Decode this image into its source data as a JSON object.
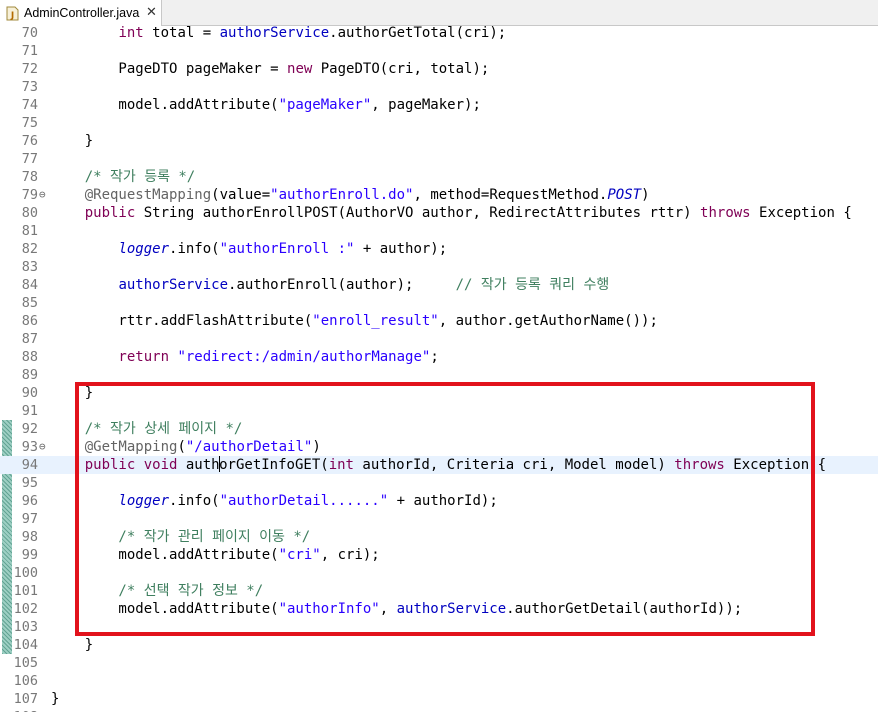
{
  "tab": {
    "title": "AdminController.java",
    "icon": "java-file-icon",
    "close": "✕"
  },
  "colors": {
    "keyword": "#7f0055",
    "string": "#2a00ff",
    "comment": "#3f7f5f",
    "annotation": "#646464",
    "field": "#0000c0",
    "highlight_border": "#e2121c",
    "current_line": "#e8f2fe"
  },
  "editor": {
    "lines": [
      {
        "n": "70",
        "tokens": [
          [
            "p",
            "        "
          ],
          [
            "kw",
            "int"
          ],
          [
            "p",
            " total = "
          ],
          [
            "fld",
            "authorService"
          ],
          [
            "p",
            ".authorGetTotal(cri);"
          ]
        ]
      },
      {
        "n": "71",
        "tokens": []
      },
      {
        "n": "72",
        "tokens": [
          [
            "p",
            "        PageDTO pageMaker = "
          ],
          [
            "kw",
            "new"
          ],
          [
            "p",
            " PageDTO(cri, total);"
          ]
        ]
      },
      {
        "n": "73",
        "tokens": []
      },
      {
        "n": "74",
        "tokens": [
          [
            "p",
            "        model.addAttribute("
          ],
          [
            "str",
            "\"pageMaker\""
          ],
          [
            "p",
            ", pageMaker);"
          ]
        ]
      },
      {
        "n": "75",
        "tokens": []
      },
      {
        "n": "76",
        "tokens": [
          [
            "p",
            "    }"
          ]
        ]
      },
      {
        "n": "77",
        "tokens": []
      },
      {
        "n": "78",
        "tokens": [
          [
            "com",
            "    /* 작가 등록 */"
          ]
        ]
      },
      {
        "n": "79",
        "fold": "⊖",
        "tokens": [
          [
            "ann",
            "    @RequestMapping"
          ],
          [
            "p",
            "(value="
          ],
          [
            "str",
            "\"authorEnroll.do\""
          ],
          [
            "p",
            ", method=RequestMethod."
          ],
          [
            "cst",
            "POST"
          ],
          [
            "p",
            ")"
          ]
        ]
      },
      {
        "n": "80",
        "tokens": [
          [
            "kw",
            "    public"
          ],
          [
            "p",
            " String authorEnrollPOST(AuthorVO author, RedirectAttributes rttr) "
          ],
          [
            "kw",
            "throws"
          ],
          [
            "p",
            " Exception {"
          ]
        ]
      },
      {
        "n": "81",
        "tokens": []
      },
      {
        "n": "82",
        "tokens": [
          [
            "p",
            "        "
          ],
          [
            "sfld",
            "logger"
          ],
          [
            "p",
            ".info("
          ],
          [
            "str",
            "\"authorEnroll :\""
          ],
          [
            "p",
            " + author);"
          ]
        ]
      },
      {
        "n": "83",
        "tokens": []
      },
      {
        "n": "84",
        "tokens": [
          [
            "p",
            "        "
          ],
          [
            "fld",
            "authorService"
          ],
          [
            "p",
            ".authorEnroll(author);     "
          ],
          [
            "com",
            "// 작가 등록 쿼리 수행"
          ]
        ]
      },
      {
        "n": "85",
        "tokens": []
      },
      {
        "n": "86",
        "tokens": [
          [
            "p",
            "        rttr.addFlashAttribute("
          ],
          [
            "str",
            "\"enroll_result\""
          ],
          [
            "p",
            ", author.getAuthorName());"
          ]
        ]
      },
      {
        "n": "87",
        "tokens": []
      },
      {
        "n": "88",
        "tokens": [
          [
            "kw",
            "        return"
          ],
          [
            "p",
            " "
          ],
          [
            "str",
            "\"redirect:/admin/authorManage\""
          ],
          [
            "p",
            ";"
          ]
        ]
      },
      {
        "n": "89",
        "tokens": []
      },
      {
        "n": "90",
        "tokens": [
          [
            "p",
            "    }"
          ]
        ]
      },
      {
        "n": "91",
        "tokens": []
      },
      {
        "n": "92",
        "tokens": [
          [
            "com",
            "    /* 작가 상세 페이지 */"
          ]
        ]
      },
      {
        "n": "93",
        "fold": "⊖",
        "tokens": [
          [
            "ann",
            "    @GetMapping"
          ],
          [
            "p",
            "("
          ],
          [
            "str",
            "\"/authorDetail\""
          ],
          [
            "p",
            ")"
          ]
        ]
      },
      {
        "n": "94",
        "current": true,
        "tokens": [
          [
            "kw",
            "    public"
          ],
          [
            "p",
            " "
          ],
          [
            "kw",
            "void"
          ],
          [
            "p",
            " auth"
          ],
          [
            "caret",
            ""
          ],
          [
            "p",
            "orGetInfoGET("
          ],
          [
            "kw",
            "int"
          ],
          [
            "p",
            " authorId, Criteria cri, Model model) "
          ],
          [
            "kw",
            "throws"
          ],
          [
            "p",
            " Exception {"
          ]
        ]
      },
      {
        "n": "95",
        "tokens": []
      },
      {
        "n": "96",
        "tokens": [
          [
            "p",
            "        "
          ],
          [
            "sfld",
            "logger"
          ],
          [
            "p",
            ".info("
          ],
          [
            "str",
            "\"authorDetail......\""
          ],
          [
            "p",
            " + authorId);"
          ]
        ]
      },
      {
        "n": "97",
        "tokens": []
      },
      {
        "n": "98",
        "tokens": [
          [
            "com",
            "        /* 작가 관리 페이지 이동 */"
          ]
        ]
      },
      {
        "n": "99",
        "tokens": [
          [
            "p",
            "        model.addAttribute("
          ],
          [
            "str",
            "\"cri\""
          ],
          [
            "p",
            ", cri);"
          ]
        ]
      },
      {
        "n": "100",
        "tokens": []
      },
      {
        "n": "101",
        "tokens": [
          [
            "com",
            "        /* 선택 작가 정보 */"
          ]
        ]
      },
      {
        "n": "102",
        "tokens": [
          [
            "p",
            "        model.addAttribute("
          ],
          [
            "str",
            "\"authorInfo\""
          ],
          [
            "p",
            ", "
          ],
          [
            "fld",
            "authorService"
          ],
          [
            "p",
            ".authorGetDetail(authorId));"
          ]
        ]
      },
      {
        "n": "103",
        "tokens": []
      },
      {
        "n": "104",
        "tokens": [
          [
            "p",
            "    }"
          ]
        ]
      },
      {
        "n": "105",
        "tokens": []
      },
      {
        "n": "106",
        "tokens": []
      },
      {
        "n": "107",
        "tokens": [
          [
            "p",
            "}"
          ]
        ]
      },
      {
        "n": "108",
        "tokens": []
      }
    ],
    "changed_ranges": [
      [
        "92",
        "104"
      ]
    ]
  }
}
